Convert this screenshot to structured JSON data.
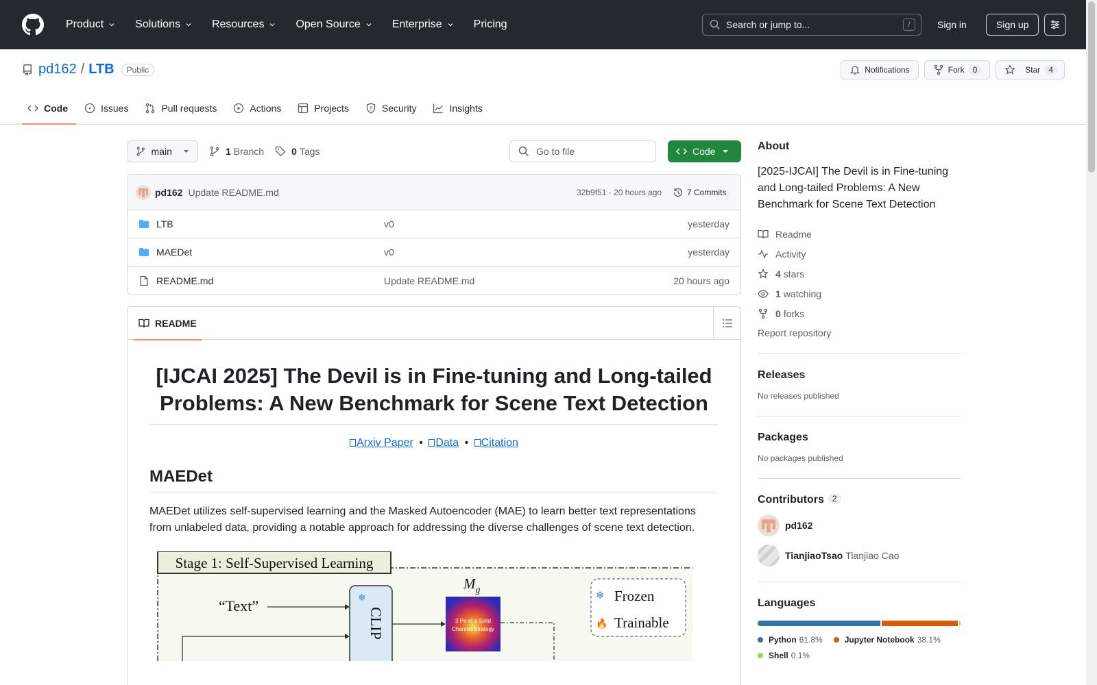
{
  "header": {
    "nav": [
      {
        "label": "Product",
        "dropdown": true
      },
      {
        "label": "Solutions",
        "dropdown": true
      },
      {
        "label": "Resources",
        "dropdown": true
      },
      {
        "label": "Open Source",
        "dropdown": true
      },
      {
        "label": "Enterprise",
        "dropdown": true
      },
      {
        "label": "Pricing",
        "dropdown": false
      }
    ],
    "search_placeholder": "Search or jump to...",
    "search_shortcut": "/",
    "sign_in": "Sign in",
    "sign_up": "Sign up"
  },
  "repo": {
    "owner": "pd162",
    "separator": "/",
    "name": "LTB",
    "visibility": "Public",
    "notifications_label": "Notifications",
    "fork_label": "Fork",
    "fork_count": "0",
    "star_label": "Star",
    "star_count": "4"
  },
  "tabs": [
    {
      "label": "Code",
      "icon": "code-icon",
      "active": true
    },
    {
      "label": "Issues",
      "icon": "issue-icon",
      "active": false
    },
    {
      "label": "Pull requests",
      "icon": "pull-request-icon",
      "active": false
    },
    {
      "label": "Actions",
      "icon": "play-icon",
      "active": false
    },
    {
      "label": "Projects",
      "icon": "table-icon",
      "active": false
    },
    {
      "label": "Security",
      "icon": "shield-icon",
      "active": false
    },
    {
      "label": "Insights",
      "icon": "graph-icon",
      "active": false
    }
  ],
  "filebar": {
    "branch": "main",
    "branches_count": "1",
    "branches_label": "Branch",
    "tags_count": "0",
    "tags_label": "Tags",
    "goto_placeholder": "Go to file",
    "code_button": "Code"
  },
  "latest_commit": {
    "user": "pd162",
    "message": "Update README.md",
    "sha_time": "32b9f51 · 20 hours ago",
    "commits_label": "7 Commits"
  },
  "files": [
    {
      "type": "dir",
      "name": "LTB",
      "message": "v0",
      "date": "yesterday"
    },
    {
      "type": "dir",
      "name": "MAEDet",
      "message": "v0",
      "date": "yesterday"
    },
    {
      "type": "file",
      "name": "README.md",
      "message": "Update README.md",
      "date": "20 hours ago"
    }
  ],
  "readme": {
    "tab_label": "README",
    "title": "[IJCAI 2025] The Devil is in Fine-tuning and Long-tailed Problems: A New Benchmark for Scene Text Detection",
    "links": [
      "Arxiv Paper",
      "Data",
      "Citation"
    ],
    "link_sep": "•",
    "h2": "MAEDet",
    "paragraph": "MAEDet utilizes self-supervised learning and the Masked Autoencoder (MAE) to learn better text representations from unlabeled data, providing a notable approach for addressing the diverse challenges of scene text detection.",
    "figure": {
      "stage_title": "Stage 1: Self-Supervised Learning",
      "text_input": "“Text”",
      "clip_label": "CLIP",
      "mg_label": "M",
      "mg_sub": "g",
      "heatmap_text_1": "3 Pe of a Solid",
      "heatmap_text_2": "Channel Strategy",
      "legend_frozen": "Frozen",
      "legend_trainable": "Trainable"
    }
  },
  "sidebar": {
    "about_heading": "About",
    "about_desc": "[2025-IJCAI] The Devil is in Fine-tuning and Long-tailed Problems: A New Benchmark for Scene Text Detection",
    "readme_link": "Readme",
    "activity_link": "Activity",
    "stars_count": "4",
    "stars_label": "stars",
    "watching_count": "1",
    "watching_label": "watching",
    "forks_count": "0",
    "forks_label": "forks",
    "report": "Report repository",
    "releases_heading": "Releases",
    "releases_empty": "No releases published",
    "packages_heading": "Packages",
    "packages_empty": "No packages published",
    "contributors_heading": "Contributors",
    "contributors_count": "2",
    "contributors": [
      {
        "login": "pd162",
        "name": ""
      },
      {
        "login": "TianjiaoTsao",
        "name": "Tianjiao Cao"
      }
    ],
    "languages_heading": "Languages",
    "languages": [
      {
        "name": "Python",
        "percent": "61.8%",
        "share": 61.8,
        "color": "#3572A5"
      },
      {
        "name": "Jupyter Notebook",
        "percent": "38.1%",
        "share": 38.1,
        "color": "#DA5B0B"
      },
      {
        "name": "Shell",
        "percent": "0.1%",
        "share": 0.1,
        "color": "#89e051"
      }
    ]
  }
}
